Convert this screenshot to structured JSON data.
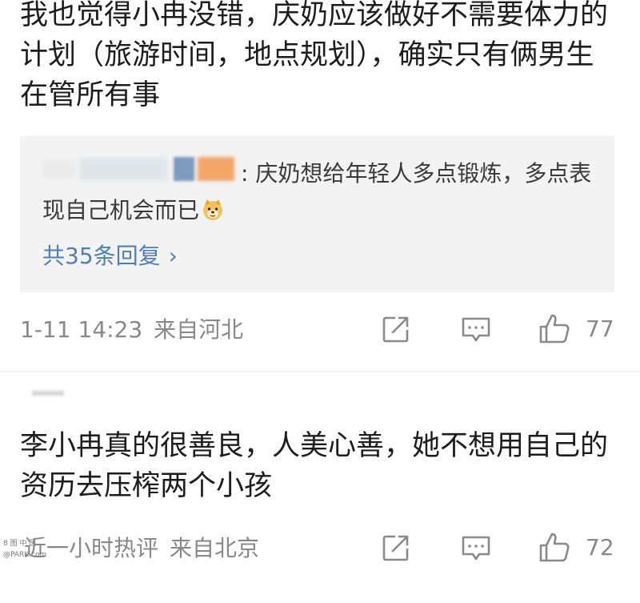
{
  "comments": [
    {
      "text": "我也觉得小冉没错，庆奶应该做好不需要体力的计划（旅游时间，地点规划），确实只有俩男生在管所有事",
      "reply": {
        "text": ": 庆奶想给年轻人多点锻炼，多点表现自己机会而已",
        "emoji_icon": "doge-icon",
        "count_label": "共35条回复",
        "chevron": "›"
      },
      "meta": {
        "time": "1-11 14:23",
        "location": "来自河北"
      },
      "likes": "77"
    },
    {
      "text": "李小冉真的很善良，人美心善，她不想用自己的资历去压榨两个小孩",
      "meta": {
        "time": "近一小时热评",
        "location": "来自北京"
      },
      "likes": "72"
    }
  ],
  "watermark": {
    "line1": "8 图 中 医",
    "line2": "@PARK.com"
  },
  "colors": {
    "link": "#4f7fb3",
    "meta": "#888888",
    "reply_bg": "#f3f3f3",
    "text": "#1d1d1d"
  },
  "icons": [
    "share-icon",
    "comment-icon",
    "like-icon"
  ]
}
